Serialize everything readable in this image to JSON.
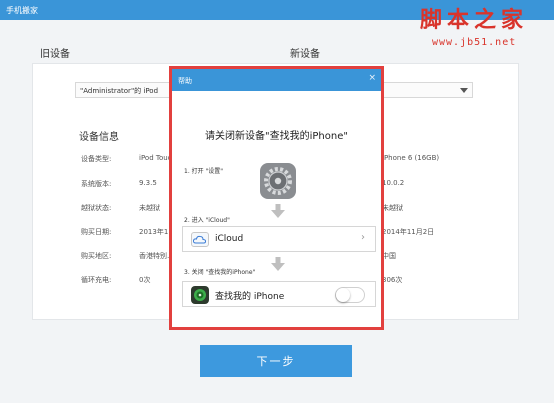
{
  "app": {
    "title": "手机搬家"
  },
  "watermark": {
    "name": "脚本之家",
    "url": "www.jb51.net"
  },
  "old_device": {
    "title": "旧设备",
    "selected": "\"Administrator\"的 iPod",
    "info_title": "设备信息",
    "fields": [
      {
        "label": "设备类型:",
        "value": "iPod Touch"
      },
      {
        "label": "系统版本:",
        "value": "9.3.5"
      },
      {
        "label": "越狱状态:",
        "value": "未越狱"
      },
      {
        "label": "购买日期:",
        "value": "2013年1…"
      },
      {
        "label": "购买地区:",
        "value": "香港特别…"
      },
      {
        "label": "循环充电:",
        "value": "0次"
      }
    ]
  },
  "new_device": {
    "title": "新设备",
    "values": [
      "iPhone 6 (16GB)",
      "10.0.2",
      "未越狱",
      "2014年11月2日",
      "中国",
      "306次"
    ]
  },
  "help_dialog": {
    "title": "帮助",
    "close": "×",
    "heading": "请关闭新设备\"查找我的iPhone\"",
    "step1": "1. 打开 \"设置\"",
    "step2": "2. 进入 \"iCloud\"",
    "step3": "3. 关闭 \"查找我的iPhone\"",
    "icloud_label": "iCloud",
    "find_label": "查找我的 iPhone",
    "find_toggle_on": false
  },
  "next_button": "下一步",
  "colors": {
    "accent": "#3a95d8",
    "highlight_border": "#e2403e"
  }
}
